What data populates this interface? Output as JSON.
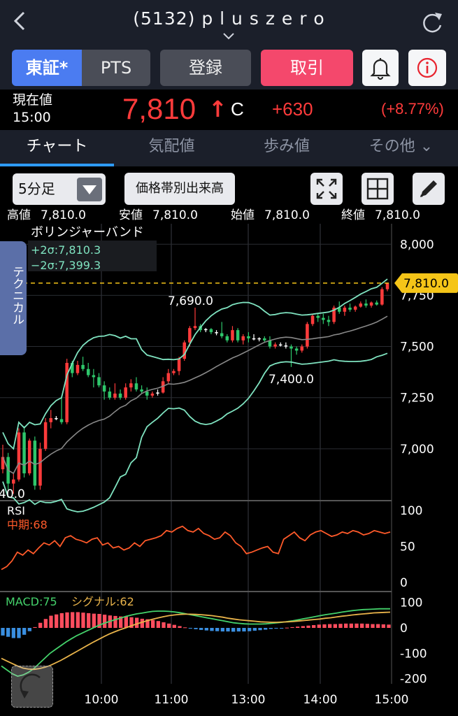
{
  "header": {
    "title": "(5132) p l u s z e r o",
    "back_icon": "chevron-left-icon",
    "refresh_icon": "refresh-icon"
  },
  "buttons": {
    "tosho": "東証*",
    "pts": "PTS",
    "register": "登録",
    "trade": "取引",
    "bell_icon": "bell-icon",
    "info_icon": "info-icon"
  },
  "quote": {
    "label_current": "現在値",
    "time": "15:00",
    "price": "7,810",
    "arrow": "↑",
    "flag": "C",
    "change": "+630",
    "change_pct": "(+8.77%)"
  },
  "tabs": [
    {
      "label": "チャート"
    },
    {
      "label": "気配値"
    },
    {
      "label": "歩み値"
    },
    {
      "label": "その他 ⌄"
    }
  ],
  "toolbar": {
    "interval": "5分足",
    "volume_button": "価格帯別出来高"
  },
  "ohlc": {
    "high_label": "高値",
    "high": "7,810.0",
    "low_label": "安値",
    "low": "7,810.0",
    "open_label": "始値",
    "open": "7,810.0",
    "close_label": "終値",
    "close": "7,810.0"
  },
  "technical_label": "テクニカル",
  "colors": {
    "up": "#ff3b3b",
    "down": "#2ec76b",
    "band": "#7fe3c0",
    "sma": "#888888",
    "rsi": "#ff5a2a",
    "macd": "#44d26b",
    "signal": "#e8b34a",
    "last_price": "#f5c518"
  },
  "chart_data": [
    {
      "type": "candlestick",
      "title": "",
      "indicator_label": "ボリンジャーバンド",
      "band_upper_label": "+2σ:7,810.3",
      "band_lower_label": "−2σ:7,399.3",
      "y_ticks": [
        "8,000",
        "7,750",
        "7,500",
        "7,250",
        "7,000"
      ],
      "ylim": [
        6750,
        8100
      ],
      "x_ticks": [
        "10:00",
        "11:00",
        "13:00",
        "14:00",
        "15:00"
      ],
      "annotations": {
        "high_label": "7,690.0",
        "low_label": "7,400.0",
        "left_label": "40.0",
        "last_price": "7,810.0"
      },
      "last_price_value": 7810,
      "candles": [
        [
          6900,
          7020,
          6880,
          6960
        ],
        [
          6960,
          6980,
          6800,
          6830
        ],
        [
          6830,
          6880,
          6780,
          6850
        ],
        [
          6850,
          7100,
          6840,
          7080
        ],
        [
          7080,
          7110,
          6860,
          6880
        ],
        [
          6880,
          7050,
          6870,
          7040
        ],
        [
          7040,
          7060,
          6800,
          6820
        ],
        [
          6820,
          7030,
          6800,
          7000
        ],
        [
          7000,
          7150,
          6990,
          7130
        ],
        [
          7130,
          7190,
          7100,
          7150
        ],
        [
          7150,
          7160,
          7140,
          7145
        ],
        [
          7145,
          7260,
          7120,
          7130
        ],
        [
          7130,
          7440,
          7120,
          7420
        ],
        [
          7420,
          7430,
          7350,
          7370
        ],
        [
          7370,
          7430,
          7360,
          7410
        ],
        [
          7410,
          7450,
          7380,
          7390
        ],
        [
          7390,
          7420,
          7350,
          7360
        ],
        [
          7360,
          7390,
          7300,
          7350
        ],
        [
          7350,
          7370,
          7300,
          7310
        ],
        [
          7310,
          7330,
          7240,
          7280
        ],
        [
          7280,
          7300,
          7240,
          7250
        ],
        [
          7250,
          7320,
          7240,
          7270
        ],
        [
          7270,
          7290,
          7240,
          7250
        ],
        [
          7250,
          7320,
          7240,
          7300
        ],
        [
          7300,
          7340,
          7280,
          7320
        ],
        [
          7320,
          7350,
          7280,
          7290
        ],
        [
          7290,
          7310,
          7270,
          7280
        ],
        [
          7280,
          7300,
          7240,
          7260
        ],
        [
          7260,
          7280,
          7250,
          7270
        ],
        [
          7270,
          7290,
          7260,
          7275
        ],
        [
          7275,
          7350,
          7270,
          7330
        ],
        [
          7330,
          7390,
          7320,
          7370
        ],
        [
          7370,
          7390,
          7360,
          7380
        ],
        [
          7380,
          7450,
          7360,
          7440
        ],
        [
          7440,
          7530,
          7430,
          7520
        ],
        [
          7520,
          7600,
          7500,
          7590
        ],
        [
          7590,
          7690,
          7580,
          7600
        ],
        [
          7600,
          7610,
          7570,
          7580
        ],
        [
          7580,
          7590,
          7570,
          7585
        ],
        [
          7585,
          7590,
          7560,
          7570
        ],
        [
          7570,
          7580,
          7555,
          7565
        ],
        [
          7565,
          7620,
          7540,
          7550
        ],
        [
          7550,
          7560,
          7520,
          7530
        ],
        [
          7530,
          7600,
          7520,
          7580
        ],
        [
          7580,
          7590,
          7520,
          7530
        ],
        [
          7530,
          7560,
          7510,
          7550
        ],
        [
          7550,
          7570,
          7520,
          7540
        ],
        [
          7540,
          7560,
          7530,
          7535
        ],
        [
          7535,
          7545,
          7525,
          7540
        ],
        [
          7540,
          7550,
          7520,
          7530
        ],
        [
          7530,
          7550,
          7490,
          7500
        ],
        [
          7500,
          7520,
          7490,
          7510
        ],
        [
          7510,
          7520,
          7500,
          7505
        ],
        [
          7505,
          7520,
          7490,
          7500
        ],
        [
          7500,
          7510,
          7400,
          7490
        ],
        [
          7490,
          7500,
          7460,
          7480
        ],
        [
          7480,
          7510,
          7470,
          7500
        ],
        [
          7500,
          7620,
          7490,
          7610
        ],
        [
          7610,
          7660,
          7600,
          7650
        ],
        [
          7650,
          7660,
          7620,
          7640
        ],
        [
          7640,
          7660,
          7610,
          7630
        ],
        [
          7630,
          7650,
          7600,
          7620
        ],
        [
          7620,
          7700,
          7610,
          7690
        ],
        [
          7690,
          7720,
          7660,
          7670
        ],
        [
          7670,
          7700,
          7650,
          7690
        ],
        [
          7690,
          7710,
          7670,
          7680
        ],
        [
          7680,
          7700,
          7670,
          7695
        ],
        [
          7695,
          7720,
          7690,
          7710
        ],
        [
          7710,
          7730,
          7690,
          7700
        ],
        [
          7700,
          7720,
          7690,
          7715
        ],
        [
          7715,
          7725,
          7700,
          7705
        ],
        [
          7705,
          7790,
          7700,
          7780
        ],
        [
          7780,
          7810,
          7770,
          7810
        ]
      ]
    },
    {
      "type": "line",
      "title": "RSI",
      "series_label": "中期:68",
      "y_ticks": [
        "100",
        "50",
        "0"
      ],
      "ylim": [
        0,
        100
      ],
      "values": [
        18,
        22,
        30,
        42,
        38,
        45,
        40,
        48,
        55,
        52,
        58,
        50,
        62,
        65,
        60,
        58,
        55,
        60,
        62,
        52,
        55,
        48,
        50,
        45,
        48,
        55,
        50,
        58,
        60,
        62,
        65,
        72,
        70,
        75,
        78,
        72,
        70,
        75,
        68,
        65,
        60,
        62,
        70,
        65,
        55,
        50,
        40,
        42,
        45,
        48,
        50,
        42,
        40,
        60,
        65,
        70,
        62,
        58,
        66,
        70,
        72,
        68,
        64,
        66,
        70,
        68,
        72,
        70,
        66,
        68,
        72,
        70,
        68,
        70
      ],
      "rsi_value": 68
    },
    {
      "type": "bar+line",
      "title": "MACD",
      "macd_label": "MACD:75",
      "signal_label": "シグナル:62",
      "y_ticks": [
        "100",
        "0",
        "-100",
        "-200"
      ],
      "ylim": [
        -220,
        110
      ],
      "macd": [
        -150,
        -165,
        -180,
        -190,
        -185,
        -175,
        -160,
        -140,
        -120,
        -100,
        -85,
        -70,
        -55,
        -42,
        -30,
        -20,
        -10,
        0,
        10,
        18,
        25,
        32,
        38,
        45,
        50,
        55,
        58,
        62,
        65,
        66,
        66,
        65,
        63,
        60,
        56,
        52,
        48,
        44,
        40,
        36,
        32,
        28,
        24,
        20,
        18,
        16,
        15,
        15,
        15,
        16,
        18,
        20,
        22,
        25,
        28,
        32,
        36,
        40,
        44,
        48,
        52,
        55,
        58,
        62,
        65,
        68,
        70,
        72,
        73,
        74,
        75,
        75,
        75
      ],
      "signal": [
        -120,
        -130,
        -140,
        -150,
        -158,
        -162,
        -163,
        -160,
        -155,
        -148,
        -138,
        -128,
        -116,
        -104,
        -92,
        -80,
        -68,
        -56,
        -45,
        -34,
        -24,
        -15,
        -7,
        0,
        8,
        15,
        22,
        28,
        34,
        39,
        44,
        48,
        51,
        53,
        54,
        54,
        53,
        52,
        50,
        48,
        45,
        42,
        38,
        35,
        32,
        30,
        28,
        26,
        24,
        23,
        22,
        22,
        23,
        24,
        25,
        27,
        29,
        31,
        33,
        35,
        38,
        40,
        43,
        46,
        48,
        51,
        53,
        55,
        57,
        59,
        60,
        61,
        62
      ],
      "histogram": [
        -30,
        -35,
        -40,
        -40,
        -27,
        -13,
        3,
        20,
        35,
        48,
        53,
        58,
        61,
        62,
        62,
        60,
        58,
        56,
        55,
        52,
        49,
        47,
        45,
        45,
        42,
        40,
        36,
        34,
        31,
        27,
        22,
        17,
        12,
        7,
        2,
        -2,
        -5,
        -8,
        -10,
        -12,
        -13,
        -14,
        -14,
        -15,
        -14,
        -14,
        -13,
        -11,
        -9,
        -7,
        -4,
        -2,
        -1,
        1,
        3,
        5,
        7,
        9,
        11,
        13,
        14,
        15,
        15,
        16,
        17,
        17,
        17,
        17,
        16,
        15,
        15,
        14,
        13
      ]
    }
  ]
}
